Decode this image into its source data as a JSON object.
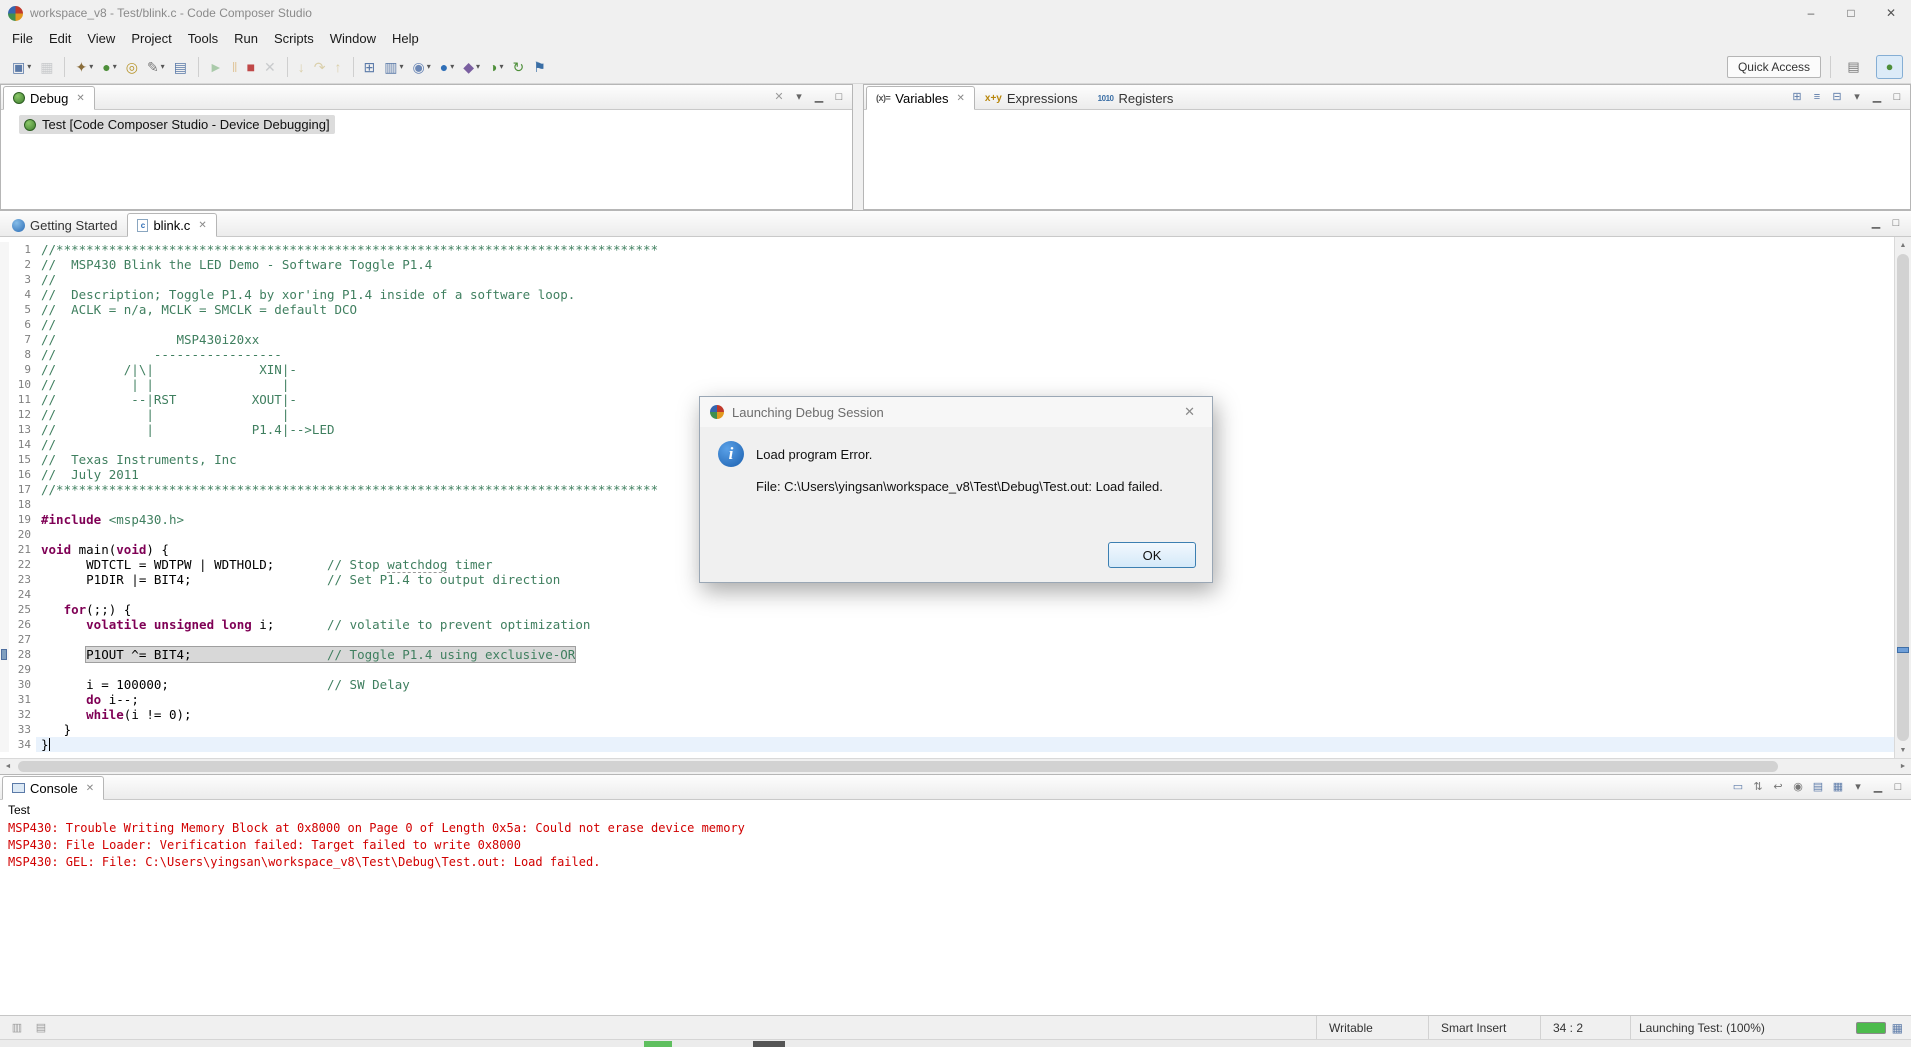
{
  "window": {
    "title": "workspace_v8 - Test/blink.c - Code Composer Studio",
    "controls": {
      "minimize": "–",
      "maximize": "□",
      "close": "✕"
    }
  },
  "glyphs": {
    "close": "✕",
    "up": "▲",
    "down": "▼",
    "left": "◄",
    "right": "►"
  },
  "menu": {
    "items": [
      "File",
      "Edit",
      "View",
      "Project",
      "Tools",
      "Run",
      "Scripts",
      "Window",
      "Help"
    ]
  },
  "toolbar": {
    "quick_access_label": "Quick Access",
    "perspectives": {
      "edit": {
        "glyph": "▤"
      },
      "debug": {
        "glyph": "●"
      }
    },
    "icons": [
      {
        "name": "new-wizard",
        "glyph": "▣",
        "color": "#5b7aa8",
        "dd": true
      },
      {
        "name": "save",
        "glyph": "▦",
        "color": "#8a8f94",
        "disabled": true
      },
      {
        "sep": true
      },
      {
        "name": "build-hammer",
        "glyph": "✦",
        "color": "#8a6d3b",
        "dd": true
      },
      {
        "name": "debug",
        "glyph": "●",
        "color": "#4e8f3a",
        "dd": true
      },
      {
        "name": "search",
        "glyph": "◎",
        "color": "#b8962e"
      },
      {
        "name": "edit-source",
        "glyph": "✎",
        "color": "#7a7a7a",
        "dd": true
      },
      {
        "name": "open-element",
        "glyph": "▤",
        "color": "#5b7aa8"
      },
      {
        "sep": true
      },
      {
        "name": "resume",
        "glyph": "►",
        "color": "#3a8f3a",
        "disabled": true
      },
      {
        "name": "suspend",
        "glyph": "‖",
        "color": "#c98a22",
        "disabled": true
      },
      {
        "name": "terminate",
        "glyph": "■",
        "color": "#c04848"
      },
      {
        "name": "disconnect",
        "glyph": "✕",
        "color": "#8a8f94",
        "disabled": true
      },
      {
        "sep": true
      },
      {
        "name": "step-into",
        "glyph": "↓",
        "color": "#b89a3a",
        "disabled": true
      },
      {
        "name": "step-over",
        "glyph": "↷",
        "color": "#b89a3a",
        "disabled": true
      },
      {
        "name": "step-return",
        "glyph": "↑",
        "color": "#b89a3a",
        "disabled": true
      },
      {
        "sep": true
      },
      {
        "name": "memory-browser",
        "glyph": "⊞",
        "color": "#5b7aa8"
      },
      {
        "name": "registers-view",
        "glyph": "▥",
        "color": "#5b7aa8",
        "dd": true
      },
      {
        "name": "watch-expression",
        "glyph": "◉",
        "color": "#6b87b5",
        "dd": true
      },
      {
        "name": "breakpoints",
        "glyph": "●",
        "color": "#2f6fb7",
        "dd": true
      },
      {
        "name": "trace-highlight",
        "glyph": "◆",
        "color": "#7a5fa0",
        "dd": true
      },
      {
        "name": "profile",
        "glyph": "◑",
        "color": "#4e8f3a",
        "dd": true
      },
      {
        "name": "target-sync",
        "glyph": "↻",
        "color": "#4e8f3a"
      },
      {
        "name": "flag-target",
        "glyph": "⚑",
        "color": "#3a6ea5"
      }
    ]
  },
  "debug_panel": {
    "tab_label": "Debug",
    "tree_item": "Test [Code Composer Studio - Device Debugging]",
    "toolbar": [
      {
        "name": "remove-all-terminated-icon",
        "glyph": "✕",
        "color": "#9a9a9a"
      },
      {
        "name": "view-menu-icon",
        "glyph": "▾",
        "color": "#666666"
      },
      {
        "name": "minimize-icon",
        "glyph": "▁",
        "color": "#666666"
      },
      {
        "name": "maximize-icon",
        "glyph": "□",
        "color": "#666666"
      }
    ]
  },
  "variables_panel": {
    "tabs": [
      {
        "icon": "(x)=",
        "label": "Variables"
      },
      {
        "icon": "x+y",
        "label": "Expressions"
      },
      {
        "icon": "1010",
        "label": "Registers"
      }
    ],
    "toolbar": [
      {
        "name": "show-type-names-icon",
        "glyph": "⊞",
        "color": "#5b7aa8"
      },
      {
        "name": "show-logical-structure-icon",
        "glyph": "≡",
        "color": "#5b7aa8"
      },
      {
        "name": "collapse-all-icon",
        "glyph": "⊟",
        "color": "#5b7aa8"
      },
      {
        "name": "view-menu-icon",
        "glyph": "▾",
        "color": "#666666"
      },
      {
        "name": "minimize-icon",
        "glyph": "▁",
        "color": "#666666"
      },
      {
        "name": "maximize-icon",
        "glyph": "□",
        "color": "#666666"
      }
    ]
  },
  "editor": {
    "tabs": [
      {
        "label": "Getting Started"
      },
      {
        "label": "blink.c",
        "active": true
      }
    ],
    "window_tools": [
      {
        "name": "minimize-icon",
        "glyph": "▁",
        "color": "#666666"
      },
      {
        "name": "maximize-icon",
        "glyph": "□",
        "color": "#666666"
      }
    ],
    "lines": [
      {
        "n": 1,
        "seg": [
          {
            "t": "c",
            "s": "//********************************************************************************"
          }
        ]
      },
      {
        "n": 2,
        "seg": [
          {
            "t": "c",
            "s": "//  MSP430 Blink the LED Demo - Software Toggle P1.4"
          }
        ]
      },
      {
        "n": 3,
        "seg": [
          {
            "t": "c",
            "s": "//"
          }
        ]
      },
      {
        "n": 4,
        "seg": [
          {
            "t": "c",
            "s": "//  Description; Toggle P1.4 by xor'ing P1.4 inside of a software loop."
          }
        ]
      },
      {
        "n": 5,
        "seg": [
          {
            "t": "c",
            "s": "//  ACLK = n/a, MCLK = SMCLK = default DCO"
          }
        ]
      },
      {
        "n": 6,
        "seg": [
          {
            "t": "c",
            "s": "//"
          }
        ]
      },
      {
        "n": 7,
        "seg": [
          {
            "t": "c",
            "s": "//                MSP430i20xx"
          }
        ]
      },
      {
        "n": 8,
        "seg": [
          {
            "t": "c",
            "s": "//             -----------------"
          }
        ]
      },
      {
        "n": 9,
        "seg": [
          {
            "t": "c",
            "s": "//         /|\\|              XIN|-"
          }
        ]
      },
      {
        "n": 10,
        "seg": [
          {
            "t": "c",
            "s": "//          | |                 |"
          }
        ]
      },
      {
        "n": 11,
        "seg": [
          {
            "t": "c",
            "s": "//          --|RST          XOUT|-"
          }
        ]
      },
      {
        "n": 12,
        "seg": [
          {
            "t": "c",
            "s": "//            |                 |"
          }
        ]
      },
      {
        "n": 13,
        "seg": [
          {
            "t": "c",
            "s": "//            |             P1.4|-->LED"
          }
        ]
      },
      {
        "n": 14,
        "seg": [
          {
            "t": "c",
            "s": "//"
          }
        ]
      },
      {
        "n": 15,
        "seg": [
          {
            "t": "c",
            "s": "//  Texas Instruments, Inc"
          }
        ]
      },
      {
        "n": 16,
        "seg": [
          {
            "t": "c",
            "s": "//  July 2011"
          }
        ]
      },
      {
        "n": 17,
        "seg": [
          {
            "t": "c",
            "s": "//********************************************************************************"
          }
        ]
      },
      {
        "n": 18,
        "seg": []
      },
      {
        "n": 19,
        "seg": [
          {
            "t": "k",
            "s": "#include"
          },
          {
            "t": "p",
            "s": " "
          },
          {
            "t": "s",
            "s": "<msp430.h>"
          }
        ]
      },
      {
        "n": 20,
        "seg": []
      },
      {
        "n": 21,
        "seg": [
          {
            "t": "k",
            "s": "void"
          },
          {
            "t": "p",
            "s": " main("
          },
          {
            "t": "k",
            "s": "void"
          },
          {
            "t": "p",
            "s": ") {"
          }
        ]
      },
      {
        "n": 22,
        "seg": [
          {
            "t": "p",
            "s": "      WDTCTL = WDTPW | WDTHOLD;       "
          },
          {
            "t": "c",
            "s": "// Stop "
          },
          {
            "t": "u",
            "s": "watchdog"
          },
          {
            "t": "c",
            "s": " timer"
          }
        ]
      },
      {
        "n": 23,
        "seg": [
          {
            "t": "p",
            "s": "      P1DIR |= BIT4;                  "
          },
          {
            "t": "c",
            "s": "// Set P1.4 to output direction"
          }
        ]
      },
      {
        "n": 24,
        "seg": []
      },
      {
        "n": 25,
        "seg": [
          {
            "t": "p",
            "s": "   "
          },
          {
            "t": "k",
            "s": "for"
          },
          {
            "t": "p",
            "s": "(;;) {"
          }
        ]
      },
      {
        "n": 26,
        "seg": [
          {
            "t": "p",
            "s": "      "
          },
          {
            "t": "k",
            "s": "volatile"
          },
          {
            "t": "p",
            "s": " "
          },
          {
            "t": "k",
            "s": "unsigned"
          },
          {
            "t": "p",
            "s": " "
          },
          {
            "t": "k",
            "s": "long"
          },
          {
            "t": "p",
            "s": " i;       "
          },
          {
            "t": "c",
            "s": "// volatile to prevent optimization"
          }
        ]
      },
      {
        "n": 27,
        "seg": []
      },
      {
        "n": 28,
        "marker": true,
        "seg": [
          {
            "t": "p",
            "s": "      "
          },
          {
            "box": [
              {
                "t": "p",
                "s": "P1OUT ^= BIT4;                  "
              },
              {
                "t": "c",
                "s": "// Toggle P1.4 using exclusive-OR"
              }
            ]
          }
        ]
      },
      {
        "n": 29,
        "seg": []
      },
      {
        "n": 30,
        "seg": [
          {
            "t": "p",
            "s": "      i = 100000;                     "
          },
          {
            "t": "c",
            "s": "// SW Delay"
          }
        ]
      },
      {
        "n": 31,
        "seg": [
          {
            "t": "p",
            "s": "      "
          },
          {
            "t": "k",
            "s": "do"
          },
          {
            "t": "p",
            "s": " i--;"
          }
        ]
      },
      {
        "n": 32,
        "seg": [
          {
            "t": "p",
            "s": "      "
          },
          {
            "t": "k",
            "s": "while"
          },
          {
            "t": "p",
            "s": "(i != 0);"
          }
        ]
      },
      {
        "n": 33,
        "seg": [
          {
            "t": "p",
            "s": "   }"
          }
        ]
      },
      {
        "n": 34,
        "cls": "cur",
        "caret": true,
        "seg": [
          {
            "t": "p",
            "s": "}"
          }
        ]
      }
    ]
  },
  "console": {
    "tab_label": "Console",
    "process_label": "Test",
    "toolbar": [
      {
        "name": "clear-console-icon",
        "glyph": "▭",
        "color": "#5b7aa8"
      },
      {
        "name": "scroll-lock-icon",
        "glyph": "⇅",
        "color": "#777777"
      },
      {
        "name": "word-wrap-icon",
        "glyph": "↩",
        "color": "#777777"
      },
      {
        "name": "pin-console-icon",
        "glyph": "◉",
        "color": "#777777"
      },
      {
        "name": "display-selected-console-icon",
        "glyph": "▤",
        "color": "#5b7aa8"
      },
      {
        "name": "open-console-icon",
        "glyph": "▦",
        "color": "#5b7aa8"
      },
      {
        "name": "view-menu-icon",
        "glyph": "▾",
        "color": "#666666"
      },
      {
        "name": "minimize-icon",
        "glyph": "▁",
        "color": "#666666"
      },
      {
        "name": "maximize-icon",
        "glyph": "□",
        "color": "#666666"
      }
    ],
    "lines": [
      "MSP430: Trouble Writing Memory Block at 0x8000 on Page 0 of Length 0x5a: Could not erase device memory",
      "MSP430: File Loader: Verification failed: Target failed to write 0x8000",
      "MSP430: GEL: File: C:\\Users\\yingsan\\workspace_v8\\Test\\Debug\\Test.out: Load failed."
    ]
  },
  "dialog": {
    "title": "Launching Debug Session",
    "message": "Load program Error.",
    "file_message": "File: C:\\Users\\yingsan\\workspace_v8\\Test\\Debug\\Test.out: Load failed.",
    "ok_label": "OK",
    "close_glyph": "✕"
  },
  "status": {
    "left_icons": [
      {
        "name": "selection-info-icon",
        "glyph": "▥",
        "color": "#9a9a9a"
      },
      {
        "name": "edit-mode-icon",
        "glyph": "▤",
        "color": "#9a9a9a"
      }
    ],
    "writable": "Writable",
    "insert_mode": "Smart Insert",
    "position": "34 : 2",
    "progress_label": "Launching Test: (100%)",
    "progress_icon_glyph": "▦"
  },
  "colors": {
    "comment": "#3f7f5f",
    "keyword": "#7f0055",
    "error_text": "#d10000",
    "current_line": "#e9f2fc",
    "occurrence": "#d8d8d8",
    "progress_green": "#4cbb4c"
  }
}
